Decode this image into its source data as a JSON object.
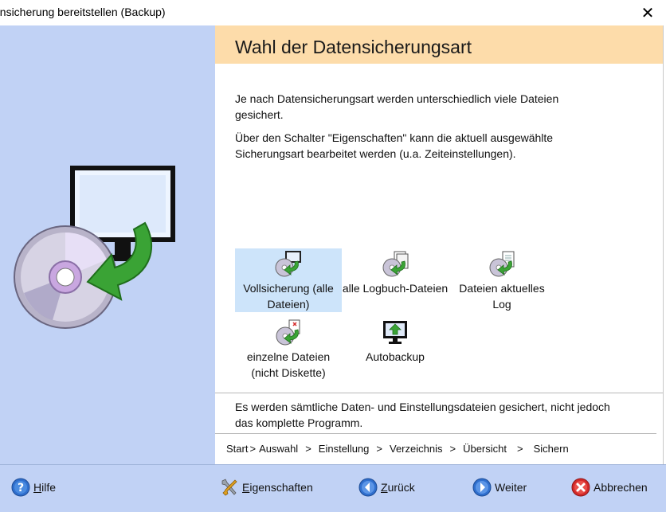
{
  "window": {
    "title": "ensicherung bereitstellen (Backup)",
    "close_glyph": "✕"
  },
  "header": {
    "title": "Wahl der Datensicherungsart"
  },
  "intro": {
    "paragraph1": "Je nach Datensicherungsart werden unterschiedlich viele Dateien gesichert.",
    "paragraph2": "Über den Schalter \"Eigenschaften\" kann die aktuell ausgewählte Sicherungsart bearbeitet werden (u.a. Zeiteinstellungen)."
  },
  "options": [
    {
      "label": "Vollsicherung (alle Dateien)",
      "icon": "full-backup-icon",
      "selected": true
    },
    {
      "label": "alle Logbuch-Dateien",
      "icon": "logbook-backup-icon",
      "selected": false
    },
    {
      "label": "Dateien aktuelles Log",
      "icon": "current-log-backup-icon",
      "selected": false
    },
    {
      "label": "einzelne Dateien (nicht Diskette)",
      "icon": "single-files-backup-icon",
      "selected": false
    },
    {
      "label": "Autobackup",
      "icon": "autobackup-monitor-icon",
      "selected": false
    }
  ],
  "description": "Es werden sämtliche Daten- und Einstellungsdateien gesichert, nicht jedoch das komplette Programm.",
  "breadcrumb": {
    "steps": [
      "Start",
      "Auswahl",
      "Einstellung",
      "Verzeichnis",
      "Übersicht",
      "Sichern"
    ],
    "separator": ">"
  },
  "buttons": {
    "help": {
      "accel": "H",
      "rest": "ilfe",
      "icon": "help-icon"
    },
    "properties": {
      "accel": "E",
      "rest": "igenschaften",
      "icon": "tools-icon"
    },
    "back": {
      "accel": "Z",
      "rest": "urück",
      "icon": "back-arrow-icon"
    },
    "next": {
      "label": "Weiter",
      "icon": "forward-arrow-icon"
    },
    "cancel": {
      "label": "Abbrechen",
      "icon": "cancel-x-icon"
    }
  },
  "colors": {
    "side_panel": "#c1d2f5",
    "header_band": "#fddcaa",
    "selection": "#cde4fa",
    "accent_green": "#3aa335",
    "accent_blue": "#2f6fce",
    "cancel_red": "#d42a2a"
  }
}
